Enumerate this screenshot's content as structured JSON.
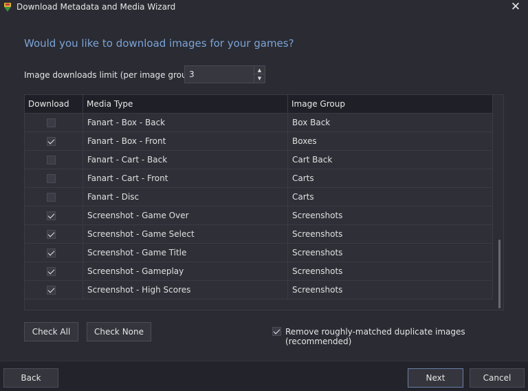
{
  "window": {
    "title": "Download Metadata and Media Wizard",
    "close_glyph": "✕"
  },
  "heading": "Would you like to download images for your games?",
  "limit": {
    "label": "Image downloads limit (per image group):",
    "value": "3"
  },
  "grid": {
    "columns": [
      "Download",
      "Media Type",
      "Image Group"
    ],
    "rows": [
      {
        "download": false,
        "media_type": "Fanart - Box - Back",
        "image_group": "Box Back"
      },
      {
        "download": true,
        "media_type": "Fanart - Box - Front",
        "image_group": "Boxes"
      },
      {
        "download": false,
        "media_type": "Fanart - Cart - Back",
        "image_group": "Cart Back"
      },
      {
        "download": false,
        "media_type": "Fanart - Cart - Front",
        "image_group": "Carts"
      },
      {
        "download": false,
        "media_type": "Fanart - Disc",
        "image_group": "Carts"
      },
      {
        "download": true,
        "media_type": "Screenshot - Game Over",
        "image_group": "Screenshots"
      },
      {
        "download": true,
        "media_type": "Screenshot - Game Select",
        "image_group": "Screenshots"
      },
      {
        "download": true,
        "media_type": "Screenshot - Game Title",
        "image_group": "Screenshots"
      },
      {
        "download": true,
        "media_type": "Screenshot - Gameplay",
        "image_group": "Screenshots"
      },
      {
        "download": true,
        "media_type": "Screenshot - High Scores",
        "image_group": "Screenshots"
      }
    ]
  },
  "buttons": {
    "check_all": "Check All",
    "check_none": "Check None",
    "back": "Back",
    "next": "Next",
    "cancel": "Cancel"
  },
  "dedupe": {
    "checked": true,
    "label": "Remove roughly-matched duplicate images (recommended)"
  },
  "colors": {
    "accent_heading": "#7ba4d6",
    "background": "#2a2b33"
  }
}
